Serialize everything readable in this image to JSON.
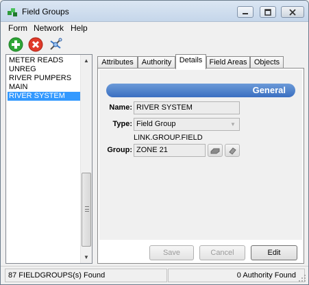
{
  "window": {
    "title": "Field Groups"
  },
  "menu": {
    "items": [
      "Form",
      "Network",
      "Help"
    ]
  },
  "list": {
    "items": [
      {
        "label": "METER READS"
      },
      {
        "label": "UNREG"
      },
      {
        "label": "RIVER PUMPERS"
      },
      {
        "label": "MAIN"
      },
      {
        "label": "RIVER SYSTEM",
        "selected": true
      }
    ]
  },
  "tabs": [
    "Attributes",
    "Authority",
    "Details",
    "Field Areas",
    "Objects"
  ],
  "active_tab": "Details",
  "details": {
    "section_title": "General",
    "name_label": "Name:",
    "name_value": "RIVER SYSTEM",
    "type_label": "Type:",
    "type_value": "Field Group",
    "type_hint": "LINK.GROUP.FIELD",
    "group_label": "Group:",
    "group_value": "ZONE 21"
  },
  "buttons": {
    "save": "Save",
    "cancel": "Cancel",
    "edit": "Edit"
  },
  "status": {
    "left": "87 FIELDGROUPS(s) Found",
    "right": "0 Authority Found"
  },
  "colors": {
    "selection": "#3399ff",
    "header": "#3a6fc1"
  }
}
